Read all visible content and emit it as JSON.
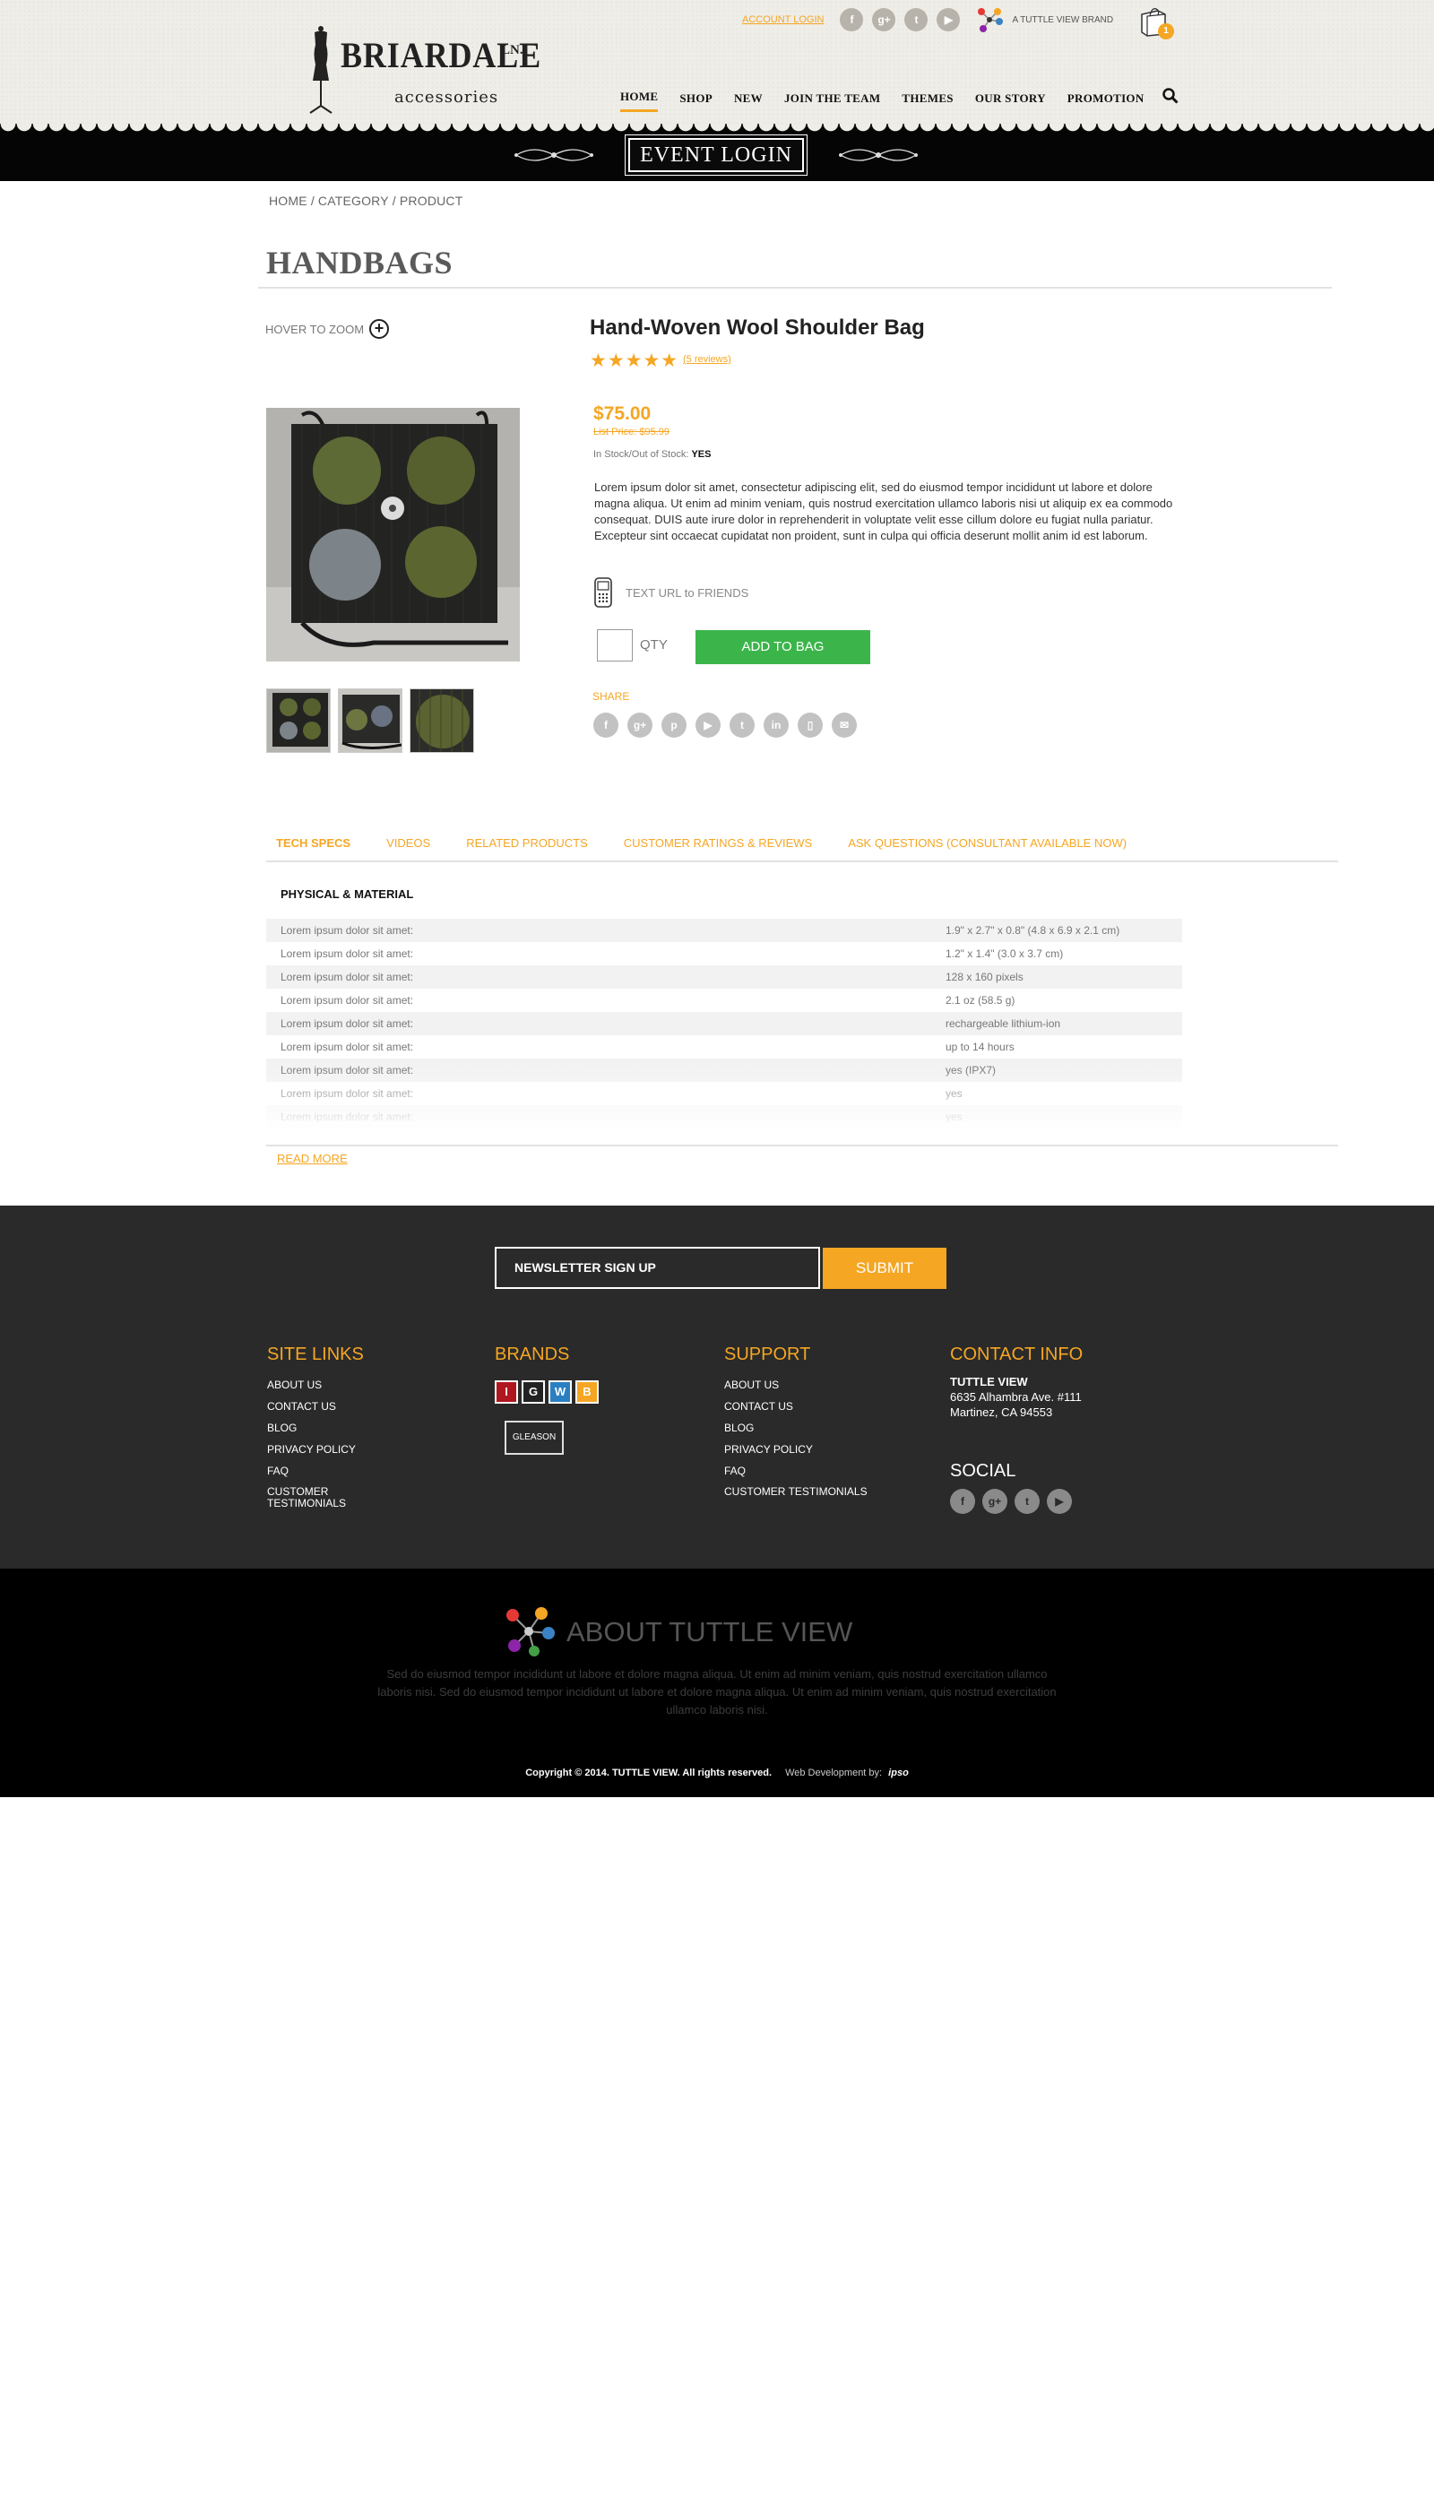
{
  "header": {
    "logo_title": "BRIARDALE",
    "logo_sup": "LN.",
    "logo_sub": "accessories",
    "account_login": "ACCOUNT LOGIN",
    "brand_tag": "A TUTTLE VIEW BRAND",
    "cart_count": "1",
    "social_top": [
      {
        "icon": "facebook-icon",
        "glyph": "f"
      },
      {
        "icon": "google-plus-icon",
        "glyph": "g+"
      },
      {
        "icon": "twitter-icon",
        "glyph": "t"
      },
      {
        "icon": "youtube-icon",
        "glyph": "▶"
      }
    ],
    "nav": [
      "HOME",
      "SHOP",
      "NEW",
      "JOIN THE TEAM",
      "THEMES",
      "OUR STORY",
      "PROMOTION"
    ],
    "event_login": "EVENT LOGIN"
  },
  "breadcrumb": [
    "HOME",
    "/",
    "CATEGORY",
    "/",
    "PRODUCT"
  ],
  "page_title": "HANDBAGS",
  "product": {
    "zoom_hint": "HOVER TO ZOOM",
    "name": "Hand-Woven Wool Shoulder Bag",
    "stars": "★★★★★",
    "rating": 5,
    "reviews_link": "(5 reviews)",
    "price": "$75.00",
    "list_price": "List Price: $95.99",
    "stock_label": "In Stock/Out of Stock:",
    "stock_value": "YES",
    "description": "Lorem ipsum dolor sit amet, consectetur adipiscing elit, sed do eiusmod tempor incididunt ut labore et dolore magna aliqua. Ut enim ad minim veniam, quis nostrud exercitation ullamco laboris nisi ut aliquip ex ea commodo consequat. DUIS aute irure dolor in reprehenderit in voluptate velit esse cillum dolore eu fugiat nulla pariatur. Excepteur sint occaecat cupidatat non proident, sunt in culpa qui officia deserunt mollit anim id est laborum.",
    "text_url": "TEXT URL to FRIENDS",
    "qty_label": "QTY",
    "qty_value": "",
    "add_to_bag": "ADD TO BAG",
    "share_label": "SHARE",
    "share_icons": [
      {
        "icon": "facebook-icon",
        "glyph": "f"
      },
      {
        "icon": "google-plus-icon",
        "glyph": "g+"
      },
      {
        "icon": "pinterest-icon",
        "glyph": "p"
      },
      {
        "icon": "youtube-icon",
        "glyph": "▶"
      },
      {
        "icon": "twitter-icon",
        "glyph": "t"
      },
      {
        "icon": "linkedin-icon",
        "glyph": "in"
      },
      {
        "icon": "phone-icon",
        "glyph": "▯"
      },
      {
        "icon": "email-icon",
        "glyph": "✉"
      }
    ]
  },
  "tabs": [
    "TECH SPECS",
    "VIDEOS",
    "RELATED PRODUCTS",
    "CUSTOMER RATINGS & REVIEWS",
    "ASK QUESTIONS (CONSULTANT AVAILABLE NOW)"
  ],
  "specs": {
    "heading": "PHYSICAL & MATERIAL",
    "rows": [
      {
        "k": "Lorem ipsum dolor sit amet:",
        "v": "1.9\" x 2.7\" x 0.8\" (4.8 x 6.9 x 2.1 cm)"
      },
      {
        "k": "Lorem ipsum dolor sit amet:",
        "v": "1.2\" x 1.4\" (3.0 x 3.7 cm)"
      },
      {
        "k": "Lorem ipsum dolor sit amet:",
        "v": "128 x 160 pixels"
      },
      {
        "k": "Lorem ipsum dolor sit amet:",
        "v": "2.1 oz (58.5 g)"
      },
      {
        "k": "Lorem ipsum dolor sit amet:",
        "v": "rechargeable lithium-ion"
      },
      {
        "k": "Lorem ipsum dolor sit amet:",
        "v": "up to 14 hours"
      },
      {
        "k": "Lorem ipsum dolor sit amet:",
        "v": "yes (IPX7)"
      },
      {
        "k": "Lorem ipsum dolor sit amet:",
        "v": "yes"
      },
      {
        "k": "Lorem ipsum dolor sit amet:",
        "v": "yes"
      }
    ],
    "read_more": "READ MORE"
  },
  "footer": {
    "newsletter_placeholder": "NEWSLETTER SIGN UP",
    "submit": "SUBMIT",
    "site_links_title": "SITE LINKS",
    "site_links": [
      "ABOUT US",
      "CONTACT US",
      "BLOG",
      "PRIVACY POLICY",
      "FAQ",
      "CUSTOMER TESTIMONIALS"
    ],
    "brands_title": "BRANDS",
    "brand_letters": [
      "I",
      "G",
      "W",
      "B"
    ],
    "brand_colors": [
      "#b0161e",
      "#222222",
      "#2a7fc1",
      "#f5a623"
    ],
    "brand2": "GLEASON",
    "support_title": "SUPPORT",
    "support_links": [
      "ABOUT US",
      "CONTACT US",
      "BLOG",
      "PRIVACY POLICY",
      "FAQ",
      "CUSTOMER TESTIMONIALS"
    ],
    "contact_title": "CONTACT INFO",
    "contact_name": "TUTTLE VIEW",
    "contact_addr1": "6635 Alhambra Ave. #111",
    "contact_addr2": "Martinez, CA 94553",
    "social_title": "SOCIAL",
    "social": [
      {
        "icon": "facebook-icon",
        "glyph": "f"
      },
      {
        "icon": "google-plus-icon",
        "glyph": "g+"
      },
      {
        "icon": "twitter-icon",
        "glyph": "t"
      },
      {
        "icon": "youtube-icon",
        "glyph": "▶"
      }
    ]
  },
  "about": {
    "title": "ABOUT TUTTLE VIEW",
    "text": "Sed do eiusmod tempor incididunt ut labore et dolore magna aliqua. Ut enim ad minim veniam, quis nostrud exercitation ullamco laboris nisi. Sed do eiusmod tempor incididunt ut labore et dolore magna aliqua. Ut enim ad minim veniam, quis nostrud exercitation ullamco laboris nisi.",
    "copyright": "Copyright © 2014. TUTTLE VIEW. All rights reserved.",
    "webdev": "Web Development by:",
    "webdev_brand": "ipso"
  },
  "colors": {
    "accent": "#f5a623",
    "add_button": "#3bb54a",
    "footer_bg": "#2a2a2a"
  }
}
